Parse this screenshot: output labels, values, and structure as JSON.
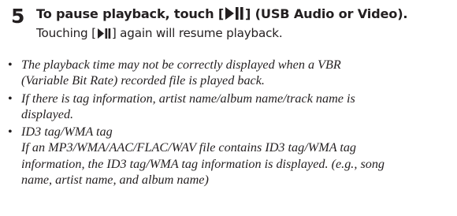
{
  "step": {
    "number": "5",
    "heading_before": "To pause playback, touch [",
    "heading_after": "] (USB Audio or Video).",
    "desc_before": "Touching [",
    "desc_after": "] again will resume playback.",
    "button_icon": "play-pause-icon"
  },
  "notes": {
    "bullet": "•",
    "items": [
      {
        "lines": [
          "The playback time may not be correctly displayed when a VBR",
          "(Variable Bit Rate) recorded file is played back."
        ]
      },
      {
        "lines": [
          "If there is tag information, artist name/album name/track name is",
          "displayed."
        ]
      },
      {
        "lines": [
          "ID3 tag/WMA tag",
          "If an MP3/WMA/AAC/FLAC/WAV file contains ID3 tag/WMA tag",
          "information, the ID3 tag/WMA tag information is displayed. (e.g., song",
          "name, artist name, and album name)"
        ]
      }
    ]
  }
}
